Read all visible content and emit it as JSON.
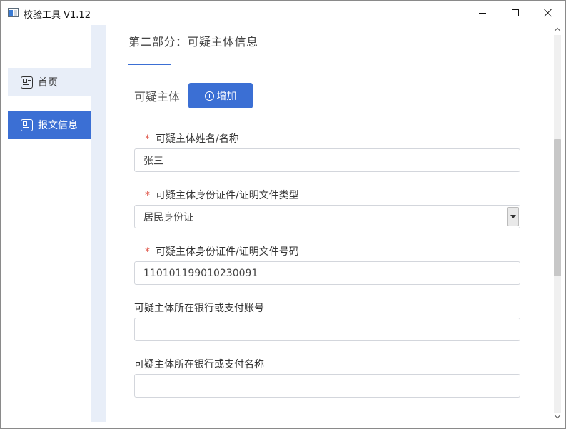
{
  "window": {
    "title": "校验工具 V1.12"
  },
  "sidebar": {
    "items": [
      {
        "label": "首页",
        "icon": "page-icon",
        "active": false
      },
      {
        "label": "报文信息",
        "icon": "page-icon",
        "active": true
      }
    ]
  },
  "main": {
    "section_title": "第二部分：可疑主体信息",
    "subject_label": "可疑主体",
    "add_button_label": "增加",
    "fields": [
      {
        "label": "可疑主体姓名/名称",
        "required": true,
        "value": "张三",
        "type": "text"
      },
      {
        "label": "可疑主体身份证件/证明文件类型",
        "required": true,
        "value": "居民身份证",
        "type": "select"
      },
      {
        "label": "可疑主体身份证件/证明文件号码",
        "required": true,
        "value": "110101199010230091",
        "type": "text"
      },
      {
        "label": "可疑主体所在银行或支付账号",
        "required": false,
        "value": "",
        "type": "text"
      },
      {
        "label": "可疑主体所在银行或支付名称",
        "required": false,
        "value": "",
        "type": "text"
      }
    ],
    "required_mark": "*"
  },
  "colors": {
    "accent": "#3b6fd4",
    "nav_inactive_bg": "#e8eef8",
    "required": "#e05a4e"
  }
}
